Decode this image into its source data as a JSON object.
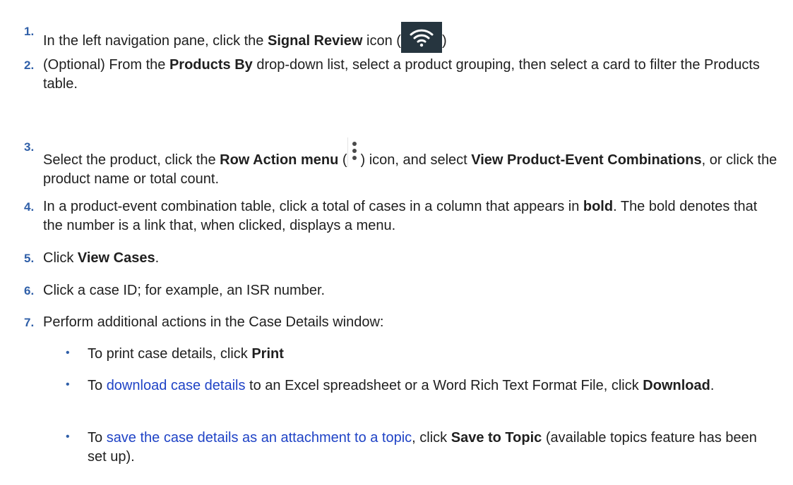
{
  "steps": [
    {
      "n": "1.",
      "pre": "In the left navigation pane, click the ",
      "bold1": "Signal Review",
      "mid": " icon (",
      "post": ")",
      "icon": "wifi-signal-icon"
    },
    {
      "n": "2.",
      "pre": "(Optional) From the ",
      "bold1": "Products By",
      "post": " drop-down list, select a product grouping, then select a card to filter the Products table."
    },
    {
      "n": "3.",
      "pre": "Select the product, click the ",
      "bold1": "Row Action menu",
      "mid": " (",
      "mid2": ") icon, and select ",
      "bold2": "View Product-Event Combinations",
      "post": ", or click the product name or total count.",
      "icon": "kebab-menu-icon"
    },
    {
      "n": "4.",
      "pre": "In a product-event combination table, click a total of cases in a column that appears in ",
      "bold1": "bold",
      "post": ". The bold denotes that the number is a link that, when clicked, displays a menu."
    },
    {
      "n": "5.",
      "pre": "Click ",
      "bold1": "View Cases",
      "post": "."
    },
    {
      "n": "6.",
      "pre": "Click a case ID; for example, an ISR number."
    },
    {
      "n": "7.",
      "pre": "Perform additional actions in the Case Details window:"
    }
  ],
  "bullets": [
    {
      "pre": "To print case details, click ",
      "bold": "Print",
      "post": ""
    },
    {
      "pre": "To ",
      "link": "download case details",
      "mid": " to an Excel spreadsheet or a Word Rich Text Format File, click ",
      "bold": "Download",
      "post": "."
    },
    {
      "pre": "To ",
      "link": "save the case details as an attachment to a topic",
      "mid": ", click ",
      "bold": "Save to Topic",
      "post": " (available topics feature has been set up)."
    }
  ],
  "colors": {
    "number": "#2f5fa8",
    "link": "#1f43c6",
    "icon_bg": "#26353f"
  }
}
